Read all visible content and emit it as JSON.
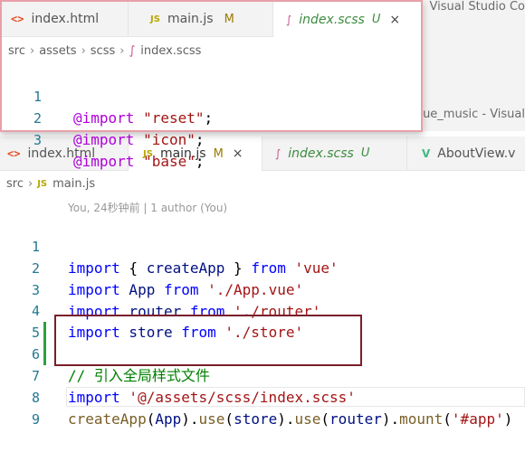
{
  "background_window": {
    "title_right": "Visual Studio Co",
    "title_right_2": "ue_music - Visual"
  },
  "main_tabs": [
    {
      "label": "index.html",
      "icon": "html-file-icon",
      "active": false
    },
    {
      "label": "main.js",
      "icon": "js-file-icon",
      "mark": "M",
      "active": true
    },
    {
      "label": "index.scss",
      "icon": "scss-file-icon",
      "mark": "U",
      "active": false
    },
    {
      "label": "AboutView.v",
      "icon": "vue-file-icon",
      "active": false
    }
  ],
  "main_breadcrumb": [
    "src",
    "main.js"
  ],
  "codelens": "You, 24秒钟前 | 1 author (You)",
  "main_code": {
    "line_numbers": [
      "1",
      "2",
      "3",
      "4",
      "5",
      "6",
      "7",
      "8",
      "9"
    ],
    "l1": {
      "kw": "import",
      "a": " { ",
      "v": "createApp",
      "b": " } ",
      "kw2": "from",
      "sp": " ",
      "s": "'vue'"
    },
    "l2": {
      "kw": "import",
      "v": " App ",
      "kw2": "from",
      "s": " './App.vue'"
    },
    "l3": {
      "kw": "import",
      "v": " router ",
      "kw2": "from",
      "s": " './router'"
    },
    "l4": {
      "kw": "import",
      "v": " store ",
      "kw2": "from",
      "s": " './store'"
    },
    "l6": {
      "c": "// 引入全局样式文件"
    },
    "l7": {
      "kw": "import",
      "s": " '@/assets/scss/index.scss'"
    },
    "l8": {
      "f1": "createApp",
      "p1": "(",
      "v1": "App",
      "p2": ").",
      "f2": "use",
      "p3": "(",
      "v2": "store",
      "p4": ").",
      "f3": "use",
      "p5": "(",
      "v3": "router",
      "p6": ").",
      "f4": "mount",
      "p7": "(",
      "s": "'#app'",
      "p8": ")"
    }
  },
  "overlay": {
    "tabs": [
      {
        "label": "index.html",
        "icon": "html-file-icon"
      },
      {
        "label": "main.js",
        "icon": "js-file-icon",
        "mark": "M"
      },
      {
        "label": "index.scss",
        "icon": "scss-file-icon",
        "mark": "U",
        "active": true
      }
    ],
    "breadcrumb": [
      "src",
      "assets",
      "scss",
      "index.scss"
    ],
    "line_numbers": [
      "1",
      "2",
      "3"
    ],
    "lines": [
      {
        "at": "@import",
        "s": "\"reset\"",
        "e": ";"
      },
      {
        "at": "@import",
        "s": "\"icon\"",
        "e": ";"
      },
      {
        "at": "@import",
        "s": "\"base\"",
        "e": ";"
      }
    ]
  },
  "icons": {
    "html": "<>",
    "js": "JS",
    "scss": "∫",
    "vue": "V",
    "close": "×",
    "chevron": "›"
  },
  "colors": {
    "keyword": "#0000ff",
    "string": "#a31515",
    "comment": "#008000",
    "highlight_box": "#7a1f2b",
    "overlay_border": "#e8a0a8",
    "added_gutter": "#2ea043"
  }
}
